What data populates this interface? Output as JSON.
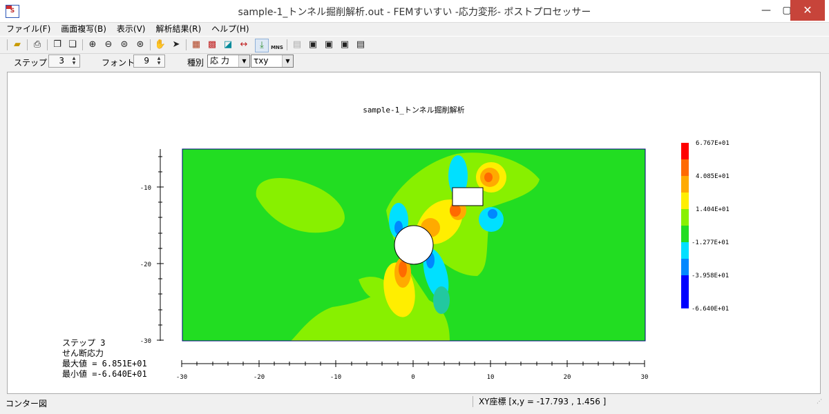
{
  "window": {
    "title": "sample-1_トンネル掘削解析.out - FEMすいすい -応力変形- ポストプロセッサー",
    "minimize_glyph": "—",
    "maximize_glyph": "▢",
    "close_glyph": "✕"
  },
  "menu": [
    "ファイル(F)",
    "画面複写(B)",
    "表示(V)",
    "解析結果(R)",
    "ヘルプ(H)"
  ],
  "toolbar": {
    "icons": [
      "open-folder-icon",
      "print-icon",
      "copy-icon",
      "copy-all-icon",
      "zoom-in-icon",
      "zoom-out-icon",
      "zoom-fit-icon",
      "zoom-window-icon",
      "pan-hand-icon",
      "select-arrow-icon",
      "mesh-icon",
      "mesh-number-icon",
      "fill-icon",
      "dimension-icon",
      "export-icon",
      "mns-icon",
      "grid-disabled-icon",
      "panel-a-icon",
      "panel-b-icon",
      "panel-c-icon",
      "panel-d-icon"
    ],
    "mns_label": "MNS"
  },
  "controls": {
    "step_label": "ステップ",
    "step_value": "3",
    "font_label": "フォント",
    "font_value": "9",
    "kind_label": "種別",
    "kind_value": "応 力",
    "component_value": "τxy"
  },
  "plot": {
    "title": "sample-1_トンネル掘削解析",
    "x_ticks": [
      "-30",
      "-20",
      "-10",
      "0",
      "10",
      "20",
      "30"
    ],
    "y_ticks": [
      "-10",
      "-20",
      "-30"
    ],
    "legend_values": [
      "6.767E+01",
      "4.085E+01",
      "1.404E+01",
      "-1.277E+01",
      "-3.958E+01",
      "-6.640E+01"
    ],
    "legend_colors": [
      "#ff0000",
      "#ff6a00",
      "#ffaa00",
      "#ffee00",
      "#88f000",
      "#22dd22",
      "#00e0ff",
      "#0088ff",
      "#0000ff"
    ],
    "info": {
      "step_line": "ステップ 3",
      "type_line": "せん断応力",
      "max_line": "最大値 = 6.851E+01",
      "min_line": "最小値 =-6.640E+01"
    }
  },
  "status": {
    "left": "コンター図",
    "coords": "XY座標 [x,y  =  -17.793 , 1.456 ]"
  }
}
